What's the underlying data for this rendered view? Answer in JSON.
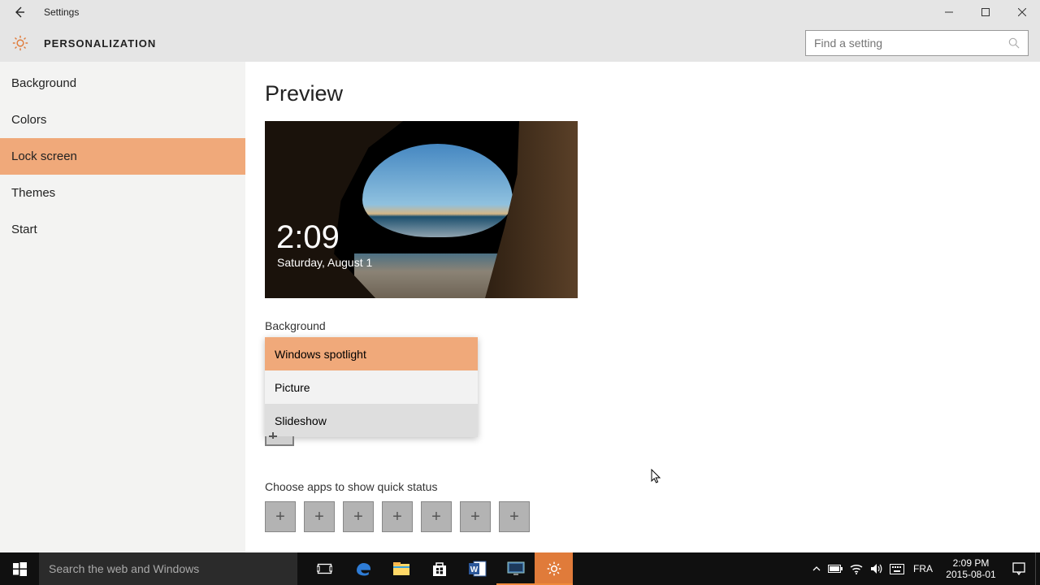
{
  "window": {
    "title": "Settings",
    "category": "PERSONALIZATION"
  },
  "search": {
    "placeholder": "Find a setting"
  },
  "sidebar": {
    "items": [
      {
        "label": "Background",
        "selected": false
      },
      {
        "label": "Colors",
        "selected": false
      },
      {
        "label": "Lock screen",
        "selected": true
      },
      {
        "label": "Themes",
        "selected": false
      },
      {
        "label": "Start",
        "selected": false
      }
    ]
  },
  "main": {
    "heading": "Preview",
    "lock_time": "2:09",
    "lock_date": "Saturday, August 1",
    "background_label": "Background",
    "background_options": [
      {
        "label": "Windows spotlight",
        "state": "selected"
      },
      {
        "label": "Picture",
        "state": ""
      },
      {
        "label": "Slideshow",
        "state": "hover"
      }
    ],
    "quick_status_label": "Choose apps to show quick status",
    "quick_status_slots": 7
  },
  "taskbar": {
    "search_placeholder": "Search the web and Windows",
    "lang": "FRA",
    "time": "2:09 PM",
    "date": "2015-08-01"
  }
}
